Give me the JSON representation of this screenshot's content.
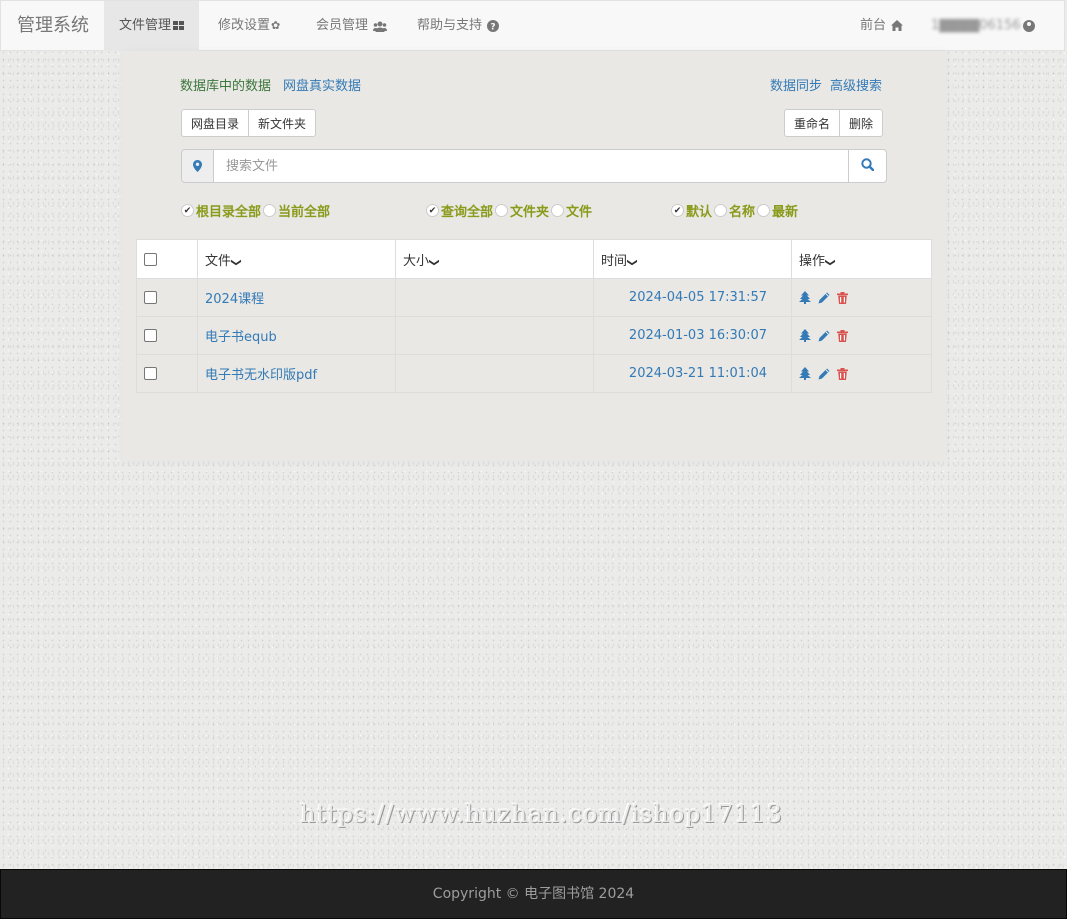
{
  "nav": {
    "brand": "管理系统",
    "items": [
      {
        "label": "文件管理",
        "icon": "th-large-icon"
      },
      {
        "label": "修改设置",
        "icon": "gear-icon"
      },
      {
        "label": "会员管理",
        "icon": "users-icon"
      },
      {
        "label": "帮助与支持",
        "icon": "question-circle-icon"
      }
    ],
    "frontend": "前台",
    "user": "1▇▇▇▇06156"
  },
  "panel": {
    "db_data": "数据库中的数据",
    "disk_data": "网盘真实数据",
    "sync": "数据同步",
    "advanced_search": "高级搜索",
    "btn_disk_dir": "网盘目录",
    "btn_new_folder": "新文件夹",
    "btn_rename": "重命名",
    "btn_delete": "删除",
    "search_placeholder": "搜索文件",
    "scope_options": [
      {
        "label": "根目录全部",
        "checked": true
      },
      {
        "label": "当前全部",
        "checked": false
      }
    ],
    "type_options": [
      {
        "label": "查询全部",
        "checked": true
      },
      {
        "label": "文件夹",
        "checked": false
      },
      {
        "label": "文件",
        "checked": false
      }
    ],
    "sort_options": [
      {
        "label": "默认",
        "checked": true
      },
      {
        "label": "名称",
        "checked": false
      },
      {
        "label": "最新",
        "checked": false
      }
    ]
  },
  "table": {
    "headers": {
      "file": "文件",
      "size": "大小",
      "time": "时间",
      "ops": "操作"
    },
    "rows": [
      {
        "name": "2024课程",
        "size": "",
        "time": "2024-04-05 17:31:57"
      },
      {
        "name": "电子书equb",
        "size": "",
        "time": "2024-01-03 16:30:07"
      },
      {
        "name": "电子书无水印版pdf",
        "size": "",
        "time": "2024-03-21 11:01:04"
      }
    ]
  },
  "watermark": "https://www.huzhan.com/ishop17113",
  "footer": "Copyright © 电子图书馆 2024",
  "colors": {
    "link": "#337ab7",
    "green_link": "#3c763d",
    "option": "#8a9a1b",
    "danger": "#d9534f"
  }
}
